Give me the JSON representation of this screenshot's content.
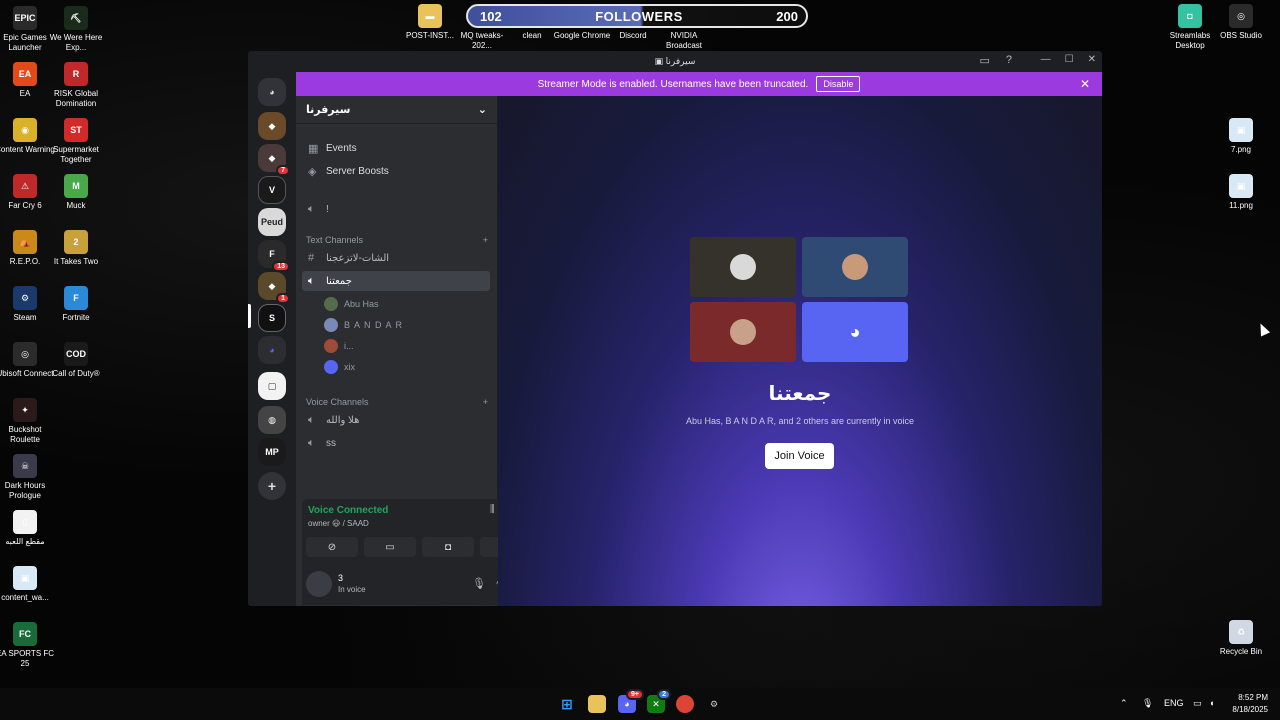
{
  "desktop": {
    "icons_left": [
      {
        "label": "Epic Games Launcher",
        "icon": "epic-games-icon",
        "glyph": "EPIC",
        "color": "#2a2a2a"
      },
      {
        "label": "We Were Here Exp...",
        "icon": "we-were-here-icon",
        "glyph": "⛏",
        "color": "#1b2b1b"
      },
      {
        "label": "EA",
        "icon": "ea-icon",
        "glyph": "EA",
        "color": "#e24a1a"
      },
      {
        "label": "RISK Global Domination",
        "icon": "risk-icon",
        "glyph": "R",
        "color": "#c0282a"
      },
      {
        "label": "Content Warning",
        "icon": "content-warning-icon",
        "glyph": "◉",
        "color": "#d9b12a"
      },
      {
        "label": "Supermarket Together",
        "icon": "supermarket-icon",
        "glyph": "ST",
        "color": "#d12a2a"
      },
      {
        "label": "Far Cry 6",
        "icon": "far-cry-icon",
        "glyph": "⚠",
        "color": "#c0282a"
      },
      {
        "label": "Muck",
        "icon": "muck-icon",
        "glyph": "M",
        "color": "#4aa84a"
      },
      {
        "label": "R.E.P.O.",
        "icon": "repo-icon",
        "glyph": "⛺",
        "color": "#c98a1a"
      },
      {
        "label": "It Takes Two",
        "icon": "it-takes-two-icon",
        "glyph": "2",
        "color": "#c9a13a"
      },
      {
        "label": "Steam",
        "icon": "steam-icon",
        "glyph": "⚙",
        "color": "#1b3a6b"
      },
      {
        "label": "Fortnite",
        "icon": "fortnite-icon",
        "glyph": "F",
        "color": "#2a8ad9"
      },
      {
        "label": "Ubisoft Connect",
        "icon": "ubisoft-icon",
        "glyph": "◎",
        "color": "#2b2b2b"
      },
      {
        "label": "Call of Duty®",
        "icon": "call-of-duty-icon",
        "glyph": "COD",
        "color": "#1a1a1a"
      },
      {
        "label": "Buckshot Roulette",
        "icon": "buckshot-icon",
        "glyph": "✦",
        "color": "#2a1a1a"
      },
      {
        "label": "Dark Hours Prologue",
        "icon": "dark-hours-icon",
        "glyph": "☠",
        "color": "#3a3a4a"
      },
      {
        "label": "مقطع اللعبه",
        "icon": "file-icon",
        "glyph": "▯",
        "color": "#f2f2f2"
      },
      {
        "label": "content_wa...",
        "icon": "image-file-icon",
        "glyph": "▣",
        "color": "#d9e8f5"
      },
      {
        "label": "EA SPORTS FC 25",
        "icon": "ea-fc-icon",
        "glyph": "FC",
        "color": "#1a6b3a"
      }
    ],
    "icons_top": [
      {
        "label": "POST-INST...",
        "icon": "folder-icon",
        "glyph": "▬",
        "color": "#e8c25a"
      },
      {
        "label": "MQ tweaks-202...",
        "icon": "mq-icon",
        "glyph": "MQ",
        "color": "#222"
      },
      {
        "label": "clean",
        "icon": "clean-icon",
        "glyph": "✧",
        "color": "#222"
      },
      {
        "label": "Google Chrome",
        "icon": "chrome-icon",
        "glyph": "◉",
        "color": "#2a2a2a"
      },
      {
        "label": "Discord",
        "icon": "discord-icon",
        "glyph": "◕",
        "color": "#2a2a2a"
      },
      {
        "label": "NVIDIA Broadcast",
        "icon": "nvidia-icon",
        "glyph": "▲",
        "color": "#2a2a2a"
      }
    ],
    "icons_right": [
      {
        "label": "Streamlabs Desktop",
        "icon": "streamlabs-icon",
        "glyph": "◘",
        "color": "#31c3a2"
      },
      {
        "label": "OBS Studio",
        "icon": "obs-icon",
        "glyph": "◎",
        "color": "#2a2a2a"
      },
      {
        "label": "7.png",
        "icon": "png-file-icon",
        "glyph": "▣",
        "color": "#d9e8f5"
      },
      {
        "label": "11.png",
        "icon": "png-file-icon",
        "glyph": "▣",
        "color": "#d9e8f5"
      },
      {
        "label": "Recycle Bin",
        "icon": "recycle-bin-icon",
        "glyph": "♻",
        "color": "#cfd8e3"
      }
    ]
  },
  "followers": {
    "current": "102",
    "label": "FOLLOWERS",
    "goal": "200",
    "progress_fraction": 0.51
  },
  "window": {
    "title": "سيرفرنا",
    "streamer_banner": "Streamer Mode is enabled. Usernames have been truncated.",
    "disable_label": "Disable"
  },
  "guilds": {
    "badges": [
      "7",
      "13",
      "1"
    ]
  },
  "sidebar": {
    "server_name": "سيرفرنا",
    "events_label": "Events",
    "boosts_label": "Server Boosts",
    "top_voice": "!",
    "text_category": "Text Channels",
    "text_channel": "الشات-لاتزعجنا",
    "active_voice": "جمعتنا",
    "members": [
      "Abu Has",
      "B A N D A R",
      "i...",
      "xix"
    ],
    "voice_category": "Voice Channels",
    "voice_channels": [
      "هلا والله",
      "ss"
    ]
  },
  "voice_panel": {
    "title": "Voice Connected",
    "subtitle": "owner 😃 / SAAD"
  },
  "user_panel": {
    "name": "3",
    "status": "In voice"
  },
  "main": {
    "channel_title": "جمعتنا",
    "subtitle": "Abu Has, B A N D A R, and 2 others are currently in voice",
    "join_label": "Join Voice",
    "tile_colors": [
      "#34322a",
      "#2f4a73",
      "#7a2a2a",
      "#5865f2"
    ]
  },
  "taskbar": {
    "lang": "ENG",
    "time": "8:52 PM",
    "date": "8/18/2025",
    "discord_badge": "9+",
    "xbox_badge": "2"
  }
}
